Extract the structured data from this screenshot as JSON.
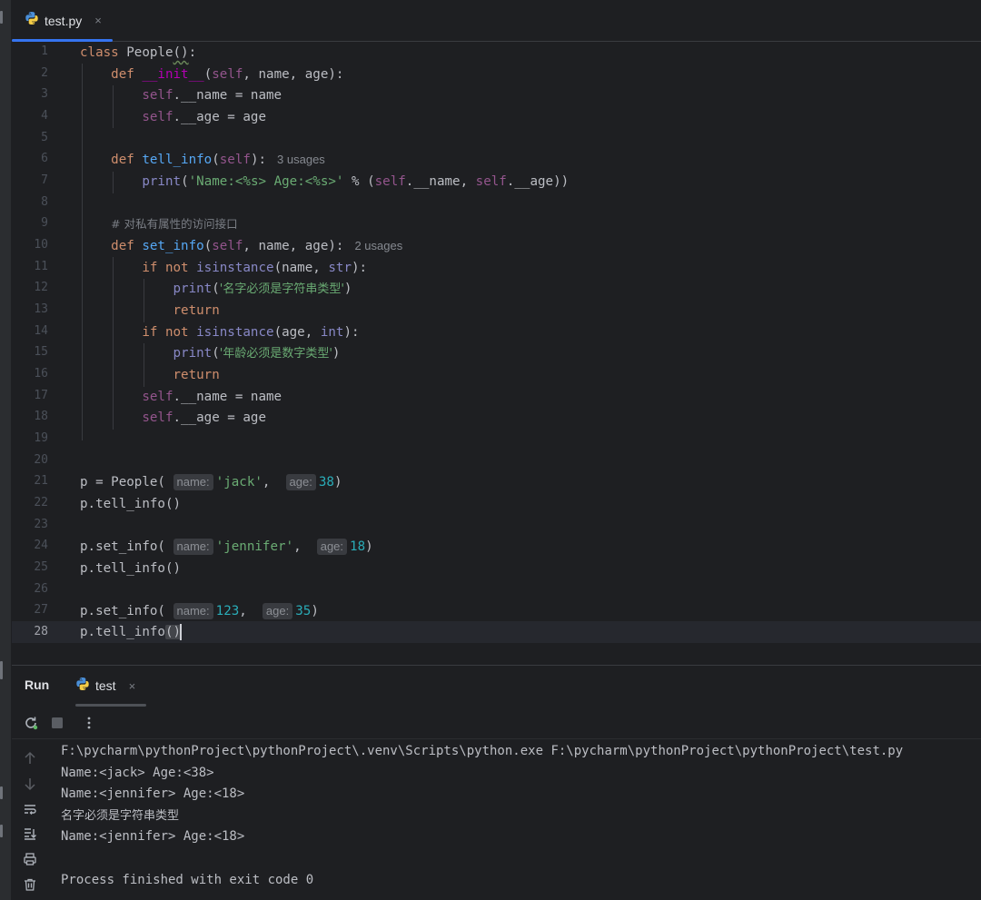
{
  "editor": {
    "tab_label": "test.py",
    "tab_close": "×",
    "line_numbers": [
      "1",
      "2",
      "3",
      "4",
      "5",
      "6",
      "7",
      "8",
      "9",
      "10",
      "11",
      "12",
      "13",
      "14",
      "15",
      "16",
      "17",
      "18",
      "19",
      "20",
      "21",
      "22",
      "23",
      "24",
      "25",
      "26",
      "27",
      "28"
    ],
    "current_line": "28",
    "code": {
      "l1_kw": "class",
      "l1_name": " People",
      "l1_paren": "()",
      "l1_colon": ":",
      "l2_def": "def",
      "l2_init": "__init__",
      "l2_open": "(",
      "l2_self": "self",
      "l2_args": ", name, age):",
      "l3_self": "self",
      "l3_rest": ".__name = name",
      "l4_self": "self",
      "l4_rest": ".__age = age",
      "l6_def": "def",
      "l6_fn": "tell_info",
      "l6_open": "(",
      "l6_self": "self",
      "l6_close": "):",
      "l6_usages": "3 usages",
      "l7_print": "print",
      "l7_open": "(",
      "l7_str": "'Name:<%s> Age:<%s>'",
      "l7_mid": " % (",
      "l7_self1": "self",
      "l7_a1": ".__name, ",
      "l7_self2": "self",
      "l7_a2": ".__age))",
      "l9_comment": "# 对私有属性的访问接口",
      "l10_def": "def",
      "l10_fn": "set_info",
      "l10_open": "(",
      "l10_self": "self",
      "l10_args": ", name, age):",
      "l10_usages": "2 usages",
      "l11_if": "if not",
      "l11_fn": "isinstance",
      "l11_args": "(name, ",
      "l11_type": "str",
      "l11_close": "):",
      "l12_print": "print",
      "l12_open": "(",
      "l12_str": "'名字必须是字符串类型'",
      "l12_close": ")",
      "l13_return": "return",
      "l14_if": "if not",
      "l14_fn": "isinstance",
      "l14_args": "(age, ",
      "l14_type": "int",
      "l14_close": "):",
      "l15_print": "print",
      "l15_open": "(",
      "l15_str": "'年龄必须是数字类型'",
      "l15_close": ")",
      "l16_return": "return",
      "l17_self": "self",
      "l17_rest": ".__name = name",
      "l18_self": "self",
      "l18_rest": ".__age = age",
      "l21_pre": "p = People(",
      "l21_h1": "name:",
      "l21_v1": "'jack'",
      "l21_sep": ", ",
      "l21_h2": "age:",
      "l21_v2": "38",
      "l21_close": ")",
      "l22": "p.tell_info()",
      "l24_pre": "p.set_info(",
      "l24_h1": "name:",
      "l24_v1": "'jennifer'",
      "l24_sep": ", ",
      "l24_h2": "age:",
      "l24_v2": "18",
      "l24_close": ")",
      "l25": "p.tell_info()",
      "l27_pre": "p.set_info(",
      "l27_h1": "name:",
      "l27_v1": "123",
      "l27_sep": ", ",
      "l27_h2": "age:",
      "l27_v2": "35",
      "l27_close": ")",
      "l28_pre": "p.tell_info",
      "l28_paren": "()"
    }
  },
  "run": {
    "title": "Run",
    "tab_label": "test",
    "tab_close": "×",
    "output": [
      "F:\\pycharm\\pythonProject\\pythonProject\\.venv\\Scripts\\python.exe F:\\pycharm\\pythonProject\\pythonProject\\test.py",
      "Name:<jack> Age:<38>",
      "Name:<jennifer> Age:<18>",
      "名字必须是字符串类型",
      "Name:<jennifer> Age:<18>",
      "",
      "Process finished with exit code 0"
    ]
  },
  "colors": {
    "background": "#1e1f22",
    "keyword": "#cf8e6d",
    "self": "#94558d",
    "function": "#56a8f5",
    "string": "#6aab73",
    "number": "#2aacb8",
    "accent": "#3574f0"
  }
}
